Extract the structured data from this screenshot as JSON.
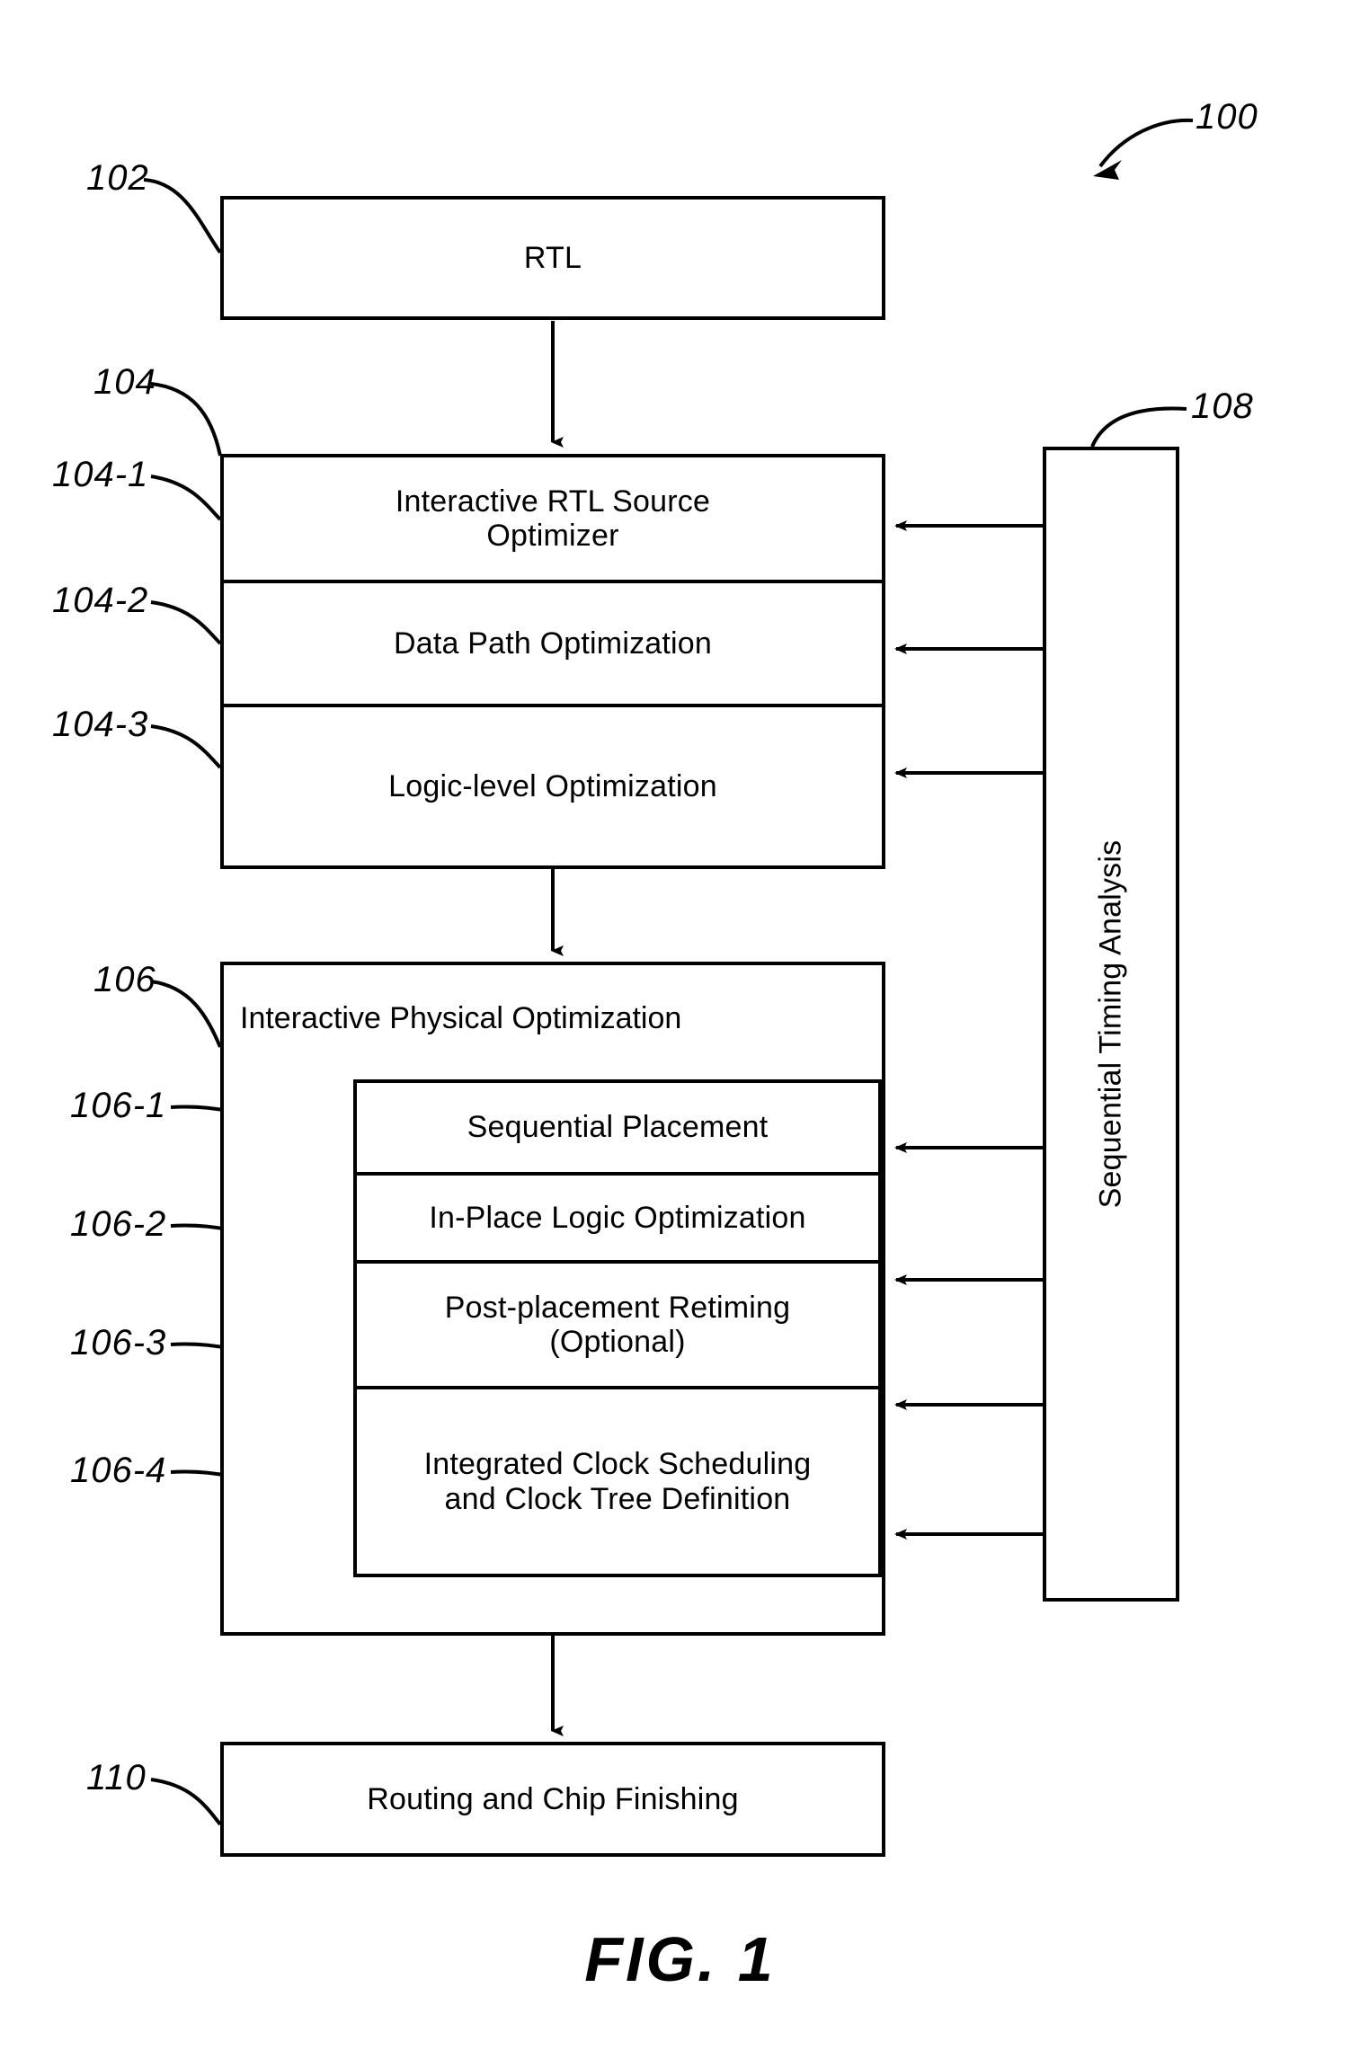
{
  "figure": {
    "caption": "FIG. 1",
    "overall_ref": "100"
  },
  "nodes": {
    "rtl": {
      "ref": "102",
      "label": "RTL"
    },
    "rtl_optimization_group": {
      "ref": "104",
      "steps": [
        {
          "ref": "104-1",
          "label": "Interactive RTL Source\nOptimizer"
        },
        {
          "ref": "104-2",
          "label": "Data Path Optimization"
        },
        {
          "ref": "104-3",
          "label": "Logic-level Optimization"
        }
      ]
    },
    "physical_optimization_group": {
      "ref": "106",
      "title": "Interactive Physical Optimization",
      "steps": [
        {
          "ref": "106-1",
          "label": "Sequential Placement"
        },
        {
          "ref": "106-2",
          "label": "In-Place Logic Optimization"
        },
        {
          "ref": "106-3",
          "label": "Post-placement Retiming\n(Optional)"
        },
        {
          "ref": "106-4",
          "label": "Integrated Clock Scheduling\nand Clock Tree Definition"
        }
      ]
    },
    "timing_analysis": {
      "ref": "108",
      "label": "Sequential Timing Analysis"
    },
    "routing": {
      "ref": "110",
      "label": "Routing and Chip Finishing"
    }
  },
  "style": {
    "line_color": "#000000",
    "background": "#ffffff"
  }
}
